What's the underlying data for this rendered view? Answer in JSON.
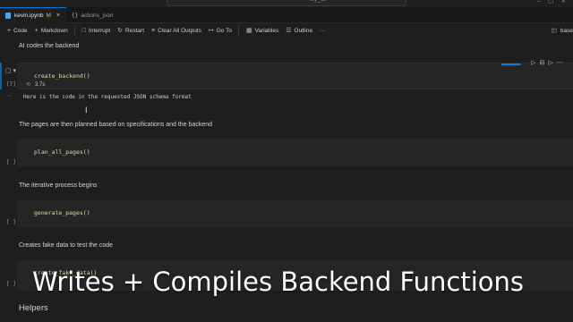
{
  "titlebar": {
    "search_text": "wy_ai",
    "controls": "– ▢ ✕"
  },
  "tabs": [
    {
      "label": "kevin.ipynb",
      "modified": "M",
      "close": "×"
    },
    {
      "label": "actions_json"
    }
  ],
  "toolbar": {
    "code": "Code",
    "markdown": "Markdown",
    "interrupt": "Interrupt",
    "restart": "Restart",
    "clear_outputs": "Clear All Outputs",
    "goto": "Go To",
    "variables": "Variables",
    "outline": "Outline",
    "more": "···",
    "kernel": "base"
  },
  "cells": {
    "md1": "AI codes the backend",
    "code1": {
      "source": "create_backend()",
      "exec": "[7]",
      "duration": "3.7s",
      "output": "Here is the code in the requested JSON schema format"
    },
    "md2": "The pages are then planned based on specifications and the backend",
    "code2": {
      "source": "plan_all_pages()",
      "exec": "[ ]"
    },
    "md3": "The iterative process begins",
    "code3": {
      "source": "generate_pages()",
      "exec": "[ ]"
    },
    "md4": "Creates fake data to test the code",
    "code4": {
      "source": "create_fake_data()",
      "exec": "[ ]"
    },
    "md5": "Helpers"
  },
  "caption": "Writes + Compiles Backend Functions"
}
